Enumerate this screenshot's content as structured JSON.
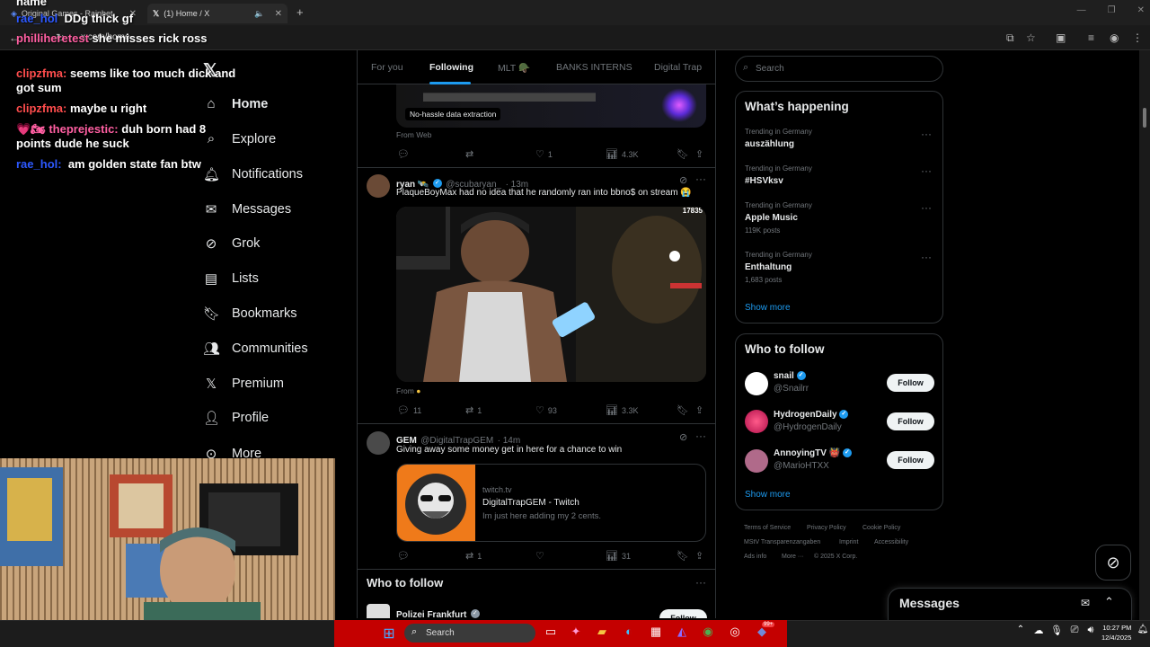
{
  "browser": {
    "tabs": [
      {
        "label": "Original Games - Rainbet"
      },
      {
        "label": "(1) Home / X"
      }
    ],
    "url_partial": "x.com/home"
  },
  "chat": [
    {
      "user": "name",
      "text": ""
    },
    {
      "user": "rae_hol",
      "text": "DDg thick gf"
    },
    {
      "user": "philliheretest",
      "text": "she misses rick ross"
    },
    {
      "user": "clipzfma:",
      "text": "seems like too much dick and got sum"
    },
    {
      "user": "clipzfma:",
      "text": "maybe u right"
    },
    {
      "user": "theprejestic:",
      "text": "duh born had 8 points dude he suck"
    },
    {
      "user": "rae_hol:",
      "text": "am golden state fan btw"
    }
  ],
  "nav": {
    "items": [
      {
        "label": "Home",
        "icon": "home-icon"
      },
      {
        "label": "Explore",
        "icon": "search-icon"
      },
      {
        "label": "Notifications",
        "icon": "bell-icon"
      },
      {
        "label": "Messages",
        "icon": "mail-icon"
      },
      {
        "label": "Grok",
        "icon": "grok-icon"
      },
      {
        "label": "Lists",
        "icon": "list-icon"
      },
      {
        "label": "Bookmarks",
        "icon": "bookmark-icon"
      },
      {
        "label": "Communities",
        "icon": "people-icon"
      },
      {
        "label": "Premium",
        "icon": "x-icon"
      },
      {
        "label": "Profile",
        "icon": "person-icon"
      },
      {
        "label": "More",
        "icon": "more-icon"
      }
    ]
  },
  "timeline": {
    "tabs": [
      "For you",
      "Following",
      "MLT 🪖",
      "BANKS INTERNS",
      "Digital Trap"
    ],
    "top_card": {
      "banner_caption": "No-hassle data extraction",
      "from": "From Web",
      "reply_count": "",
      "repost_count": "",
      "like_count": "1",
      "view_count": "4.3K"
    },
    "post1": {
      "name": "ryan 🛰️",
      "handle": "@scubaryan_",
      "time": "· 13m",
      "text": "PlaqueBoyMax had no idea that he randomly ran into bbno$ on stream 😭",
      "media_counter": "17835",
      "from": "From",
      "reply_count": "11",
      "repost_count": "1",
      "like_count": "93",
      "view_count": "3.3K"
    },
    "post2": {
      "name": "GEM",
      "handle": "@DigitalTrapGEM",
      "time": "· 14m",
      "text": "Giving away some money get in here for a chance to win",
      "card_domain": "twitch.tv",
      "card_title": "DigitalTrapGEM - Twitch",
      "card_desc": "Im just here adding my 2 cents.",
      "reply_count": "",
      "repost_count": "1",
      "like_count": "",
      "view_count": "31"
    },
    "wtf_title": "Who to follow",
    "wtf_first": {
      "name": "Polizei Frankfurt",
      "button": "Follow"
    }
  },
  "sidebar": {
    "search_placeholder": "Search",
    "happening_title": "What’s happening",
    "trends": [
      {
        "context": "Trending in Germany",
        "name": "auszählung",
        "posts": ""
      },
      {
        "context": "Trending in Germany",
        "name": "#HSVksv",
        "posts": ""
      },
      {
        "context": "Trending in Germany",
        "name": "Apple Music",
        "posts": "119K posts"
      },
      {
        "context": "Trending in Germany",
        "name": "Enthaltung",
        "posts": "1,683 posts"
      }
    ],
    "show_more": "Show more",
    "wtf_title": "Who to follow",
    "wtf": [
      {
        "name": "snail",
        "handle": "@Snailrr",
        "button": "Follow"
      },
      {
        "name": "HydrogenDaily",
        "handle": "@HydrogenDaily",
        "button": "Follow"
      },
      {
        "name": "AnnoyingTV 👹",
        "handle": "@MarioHTXX",
        "button": "Follow"
      }
    ],
    "wtf_show_more": "Show more",
    "footer": [
      "Terms of Service",
      "Privacy Policy",
      "Cookie Policy",
      "MStV Transparenzangaben",
      "Imprint",
      "Accessibility",
      "Ads info",
      "More ···",
      "© 2025 X Corp."
    ]
  },
  "messages_drawer": {
    "title": "Messages"
  },
  "taskbar": {
    "search_label": "Search",
    "time": "10:27 PM",
    "date": "12/4/2025",
    "notification_badge": "99+"
  },
  "colors": {
    "accent": "#1d9bf0",
    "chat_user": "#ff4d4d",
    "taskbar_accent": "#c40000"
  }
}
